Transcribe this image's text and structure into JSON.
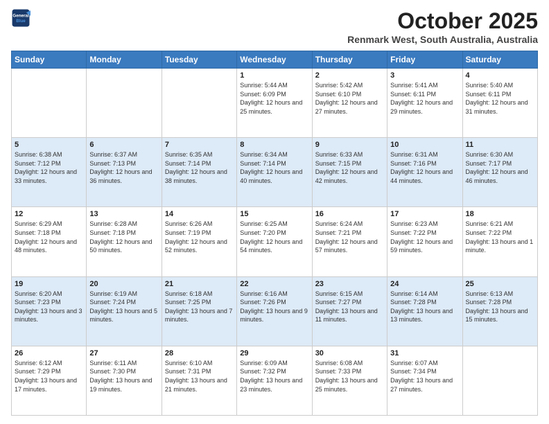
{
  "header": {
    "logo_line1": "General",
    "logo_line2": "Blue",
    "month": "October 2025",
    "location": "Renmark West, South Australia, Australia"
  },
  "weekdays": [
    "Sunday",
    "Monday",
    "Tuesday",
    "Wednesday",
    "Thursday",
    "Friday",
    "Saturday"
  ],
  "weeks": [
    [
      {
        "day": "",
        "info": ""
      },
      {
        "day": "",
        "info": ""
      },
      {
        "day": "",
        "info": ""
      },
      {
        "day": "1",
        "info": "Sunrise: 5:44 AM\nSunset: 6:09 PM\nDaylight: 12 hours and 25 minutes."
      },
      {
        "day": "2",
        "info": "Sunrise: 5:42 AM\nSunset: 6:10 PM\nDaylight: 12 hours and 27 minutes."
      },
      {
        "day": "3",
        "info": "Sunrise: 5:41 AM\nSunset: 6:11 PM\nDaylight: 12 hours and 29 minutes."
      },
      {
        "day": "4",
        "info": "Sunrise: 5:40 AM\nSunset: 6:11 PM\nDaylight: 12 hours and 31 minutes."
      }
    ],
    [
      {
        "day": "5",
        "info": "Sunrise: 6:38 AM\nSunset: 7:12 PM\nDaylight: 12 hours and 33 minutes."
      },
      {
        "day": "6",
        "info": "Sunrise: 6:37 AM\nSunset: 7:13 PM\nDaylight: 12 hours and 36 minutes."
      },
      {
        "day": "7",
        "info": "Sunrise: 6:35 AM\nSunset: 7:14 PM\nDaylight: 12 hours and 38 minutes."
      },
      {
        "day": "8",
        "info": "Sunrise: 6:34 AM\nSunset: 7:14 PM\nDaylight: 12 hours and 40 minutes."
      },
      {
        "day": "9",
        "info": "Sunrise: 6:33 AM\nSunset: 7:15 PM\nDaylight: 12 hours and 42 minutes."
      },
      {
        "day": "10",
        "info": "Sunrise: 6:31 AM\nSunset: 7:16 PM\nDaylight: 12 hours and 44 minutes."
      },
      {
        "day": "11",
        "info": "Sunrise: 6:30 AM\nSunset: 7:17 PM\nDaylight: 12 hours and 46 minutes."
      }
    ],
    [
      {
        "day": "12",
        "info": "Sunrise: 6:29 AM\nSunset: 7:18 PM\nDaylight: 12 hours and 48 minutes."
      },
      {
        "day": "13",
        "info": "Sunrise: 6:28 AM\nSunset: 7:18 PM\nDaylight: 12 hours and 50 minutes."
      },
      {
        "day": "14",
        "info": "Sunrise: 6:26 AM\nSunset: 7:19 PM\nDaylight: 12 hours and 52 minutes."
      },
      {
        "day": "15",
        "info": "Sunrise: 6:25 AM\nSunset: 7:20 PM\nDaylight: 12 hours and 54 minutes."
      },
      {
        "day": "16",
        "info": "Sunrise: 6:24 AM\nSunset: 7:21 PM\nDaylight: 12 hours and 57 minutes."
      },
      {
        "day": "17",
        "info": "Sunrise: 6:23 AM\nSunset: 7:22 PM\nDaylight: 12 hours and 59 minutes."
      },
      {
        "day": "18",
        "info": "Sunrise: 6:21 AM\nSunset: 7:22 PM\nDaylight: 13 hours and 1 minute."
      }
    ],
    [
      {
        "day": "19",
        "info": "Sunrise: 6:20 AM\nSunset: 7:23 PM\nDaylight: 13 hours and 3 minutes."
      },
      {
        "day": "20",
        "info": "Sunrise: 6:19 AM\nSunset: 7:24 PM\nDaylight: 13 hours and 5 minutes."
      },
      {
        "day": "21",
        "info": "Sunrise: 6:18 AM\nSunset: 7:25 PM\nDaylight: 13 hours and 7 minutes."
      },
      {
        "day": "22",
        "info": "Sunrise: 6:16 AM\nSunset: 7:26 PM\nDaylight: 13 hours and 9 minutes."
      },
      {
        "day": "23",
        "info": "Sunrise: 6:15 AM\nSunset: 7:27 PM\nDaylight: 13 hours and 11 minutes."
      },
      {
        "day": "24",
        "info": "Sunrise: 6:14 AM\nSunset: 7:28 PM\nDaylight: 13 hours and 13 minutes."
      },
      {
        "day": "25",
        "info": "Sunrise: 6:13 AM\nSunset: 7:28 PM\nDaylight: 13 hours and 15 minutes."
      }
    ],
    [
      {
        "day": "26",
        "info": "Sunrise: 6:12 AM\nSunset: 7:29 PM\nDaylight: 13 hours and 17 minutes."
      },
      {
        "day": "27",
        "info": "Sunrise: 6:11 AM\nSunset: 7:30 PM\nDaylight: 13 hours and 19 minutes."
      },
      {
        "day": "28",
        "info": "Sunrise: 6:10 AM\nSunset: 7:31 PM\nDaylight: 13 hours and 21 minutes."
      },
      {
        "day": "29",
        "info": "Sunrise: 6:09 AM\nSunset: 7:32 PM\nDaylight: 13 hours and 23 minutes."
      },
      {
        "day": "30",
        "info": "Sunrise: 6:08 AM\nSunset: 7:33 PM\nDaylight: 13 hours and 25 minutes."
      },
      {
        "day": "31",
        "info": "Sunrise: 6:07 AM\nSunset: 7:34 PM\nDaylight: 13 hours and 27 minutes."
      },
      {
        "day": "",
        "info": ""
      }
    ]
  ]
}
